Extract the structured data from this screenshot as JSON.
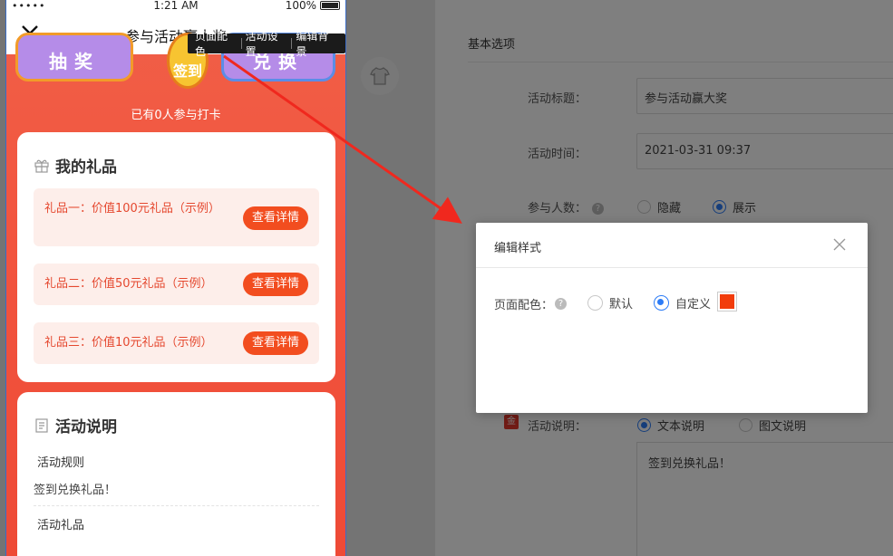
{
  "phone": {
    "status": {
      "carrier": "•••••",
      "time": "1:21 AM",
      "battery": "100%"
    },
    "nav_title": "参与活动赢大奖",
    "tooltip": {
      "page_color": "页面配色",
      "activity_settings": "活动设置",
      "edit_background": "编辑背景"
    },
    "buttons": {
      "lottery": "抽奖",
      "checkin": "签到",
      "redeem": "兑换"
    },
    "joined_text": "已有0人参与打卡",
    "gifts_title": "我的礼品",
    "gifts": [
      {
        "text": "礼品一：价值100元礼品（示例）",
        "button": "查看详情"
      },
      {
        "text": "礼品二：价值50元礼品（示例）",
        "button": "查看详情"
      },
      {
        "text": "礼品三：价值10元礼品（示例）",
        "button": "查看详情"
      }
    ],
    "desc_title": "活动说明",
    "rules_label": "活动规则",
    "rules_text": "签到兑换礼品！",
    "prizes_label": "活动礼品"
  },
  "settings": {
    "section_title": "基本选项",
    "title_label": "活动标题：",
    "title_value": "参与活动赢大奖",
    "time_label": "活动时间：",
    "time_value": "2021-03-31 09:37",
    "count_label": "参与人数：",
    "count_options": [
      "隐藏",
      "展示"
    ],
    "desc_label": "活动说明：",
    "desc_options": [
      "文本说明",
      "图文说明"
    ],
    "desc_value": "签到兑换礼品！"
  },
  "modal": {
    "title": "编辑样式",
    "label": "页面配色：",
    "options": [
      "默认",
      "自定义"
    ],
    "selected": "自定义",
    "custom_color": "#f23c0b"
  },
  "colors": {
    "accent": "#f24d1f",
    "radio_blue": "#2d7cf6",
    "arrow": "#f0281e"
  }
}
